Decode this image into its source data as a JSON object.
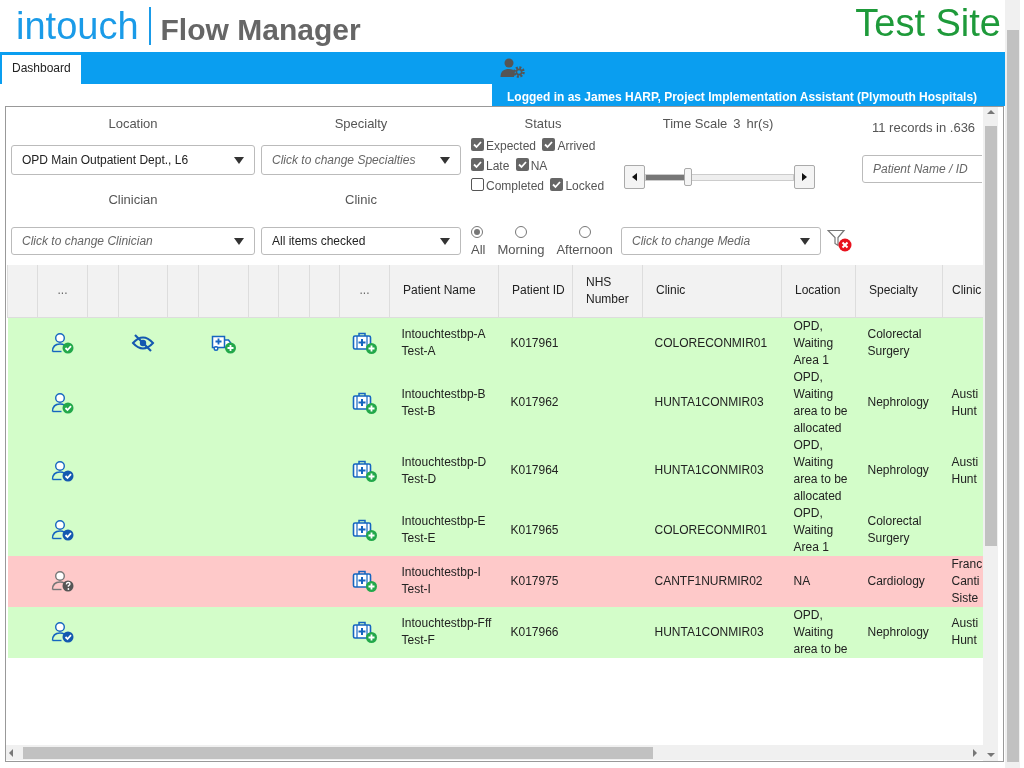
{
  "header": {
    "logo": "intouch",
    "app_name": "Flow Manager",
    "site_label": "Test Site"
  },
  "nav": {
    "tabs": [
      {
        "label": "Dashboard",
        "selected": true
      }
    ],
    "logged_in": "Logged in as James HARP, Project Implementation Assistant (Plymouth Hospitals)"
  },
  "filters": {
    "location": {
      "label": "Location",
      "value": "OPD Main Outpatient Dept., L6"
    },
    "specialty": {
      "label": "Specialty",
      "placeholder": "Click to change Specialties"
    },
    "clinician": {
      "label": "Clinician",
      "placeholder": "Click to change Clinician"
    },
    "clinic": {
      "label": "Clinic",
      "value": "All items checked"
    },
    "status": {
      "label": "Status",
      "options": [
        {
          "label": "Expected",
          "checked": true
        },
        {
          "label": "Arrived",
          "checked": true
        },
        {
          "label": "Late",
          "checked": true
        },
        {
          "label": "NA",
          "checked": true
        },
        {
          "label": "Completed",
          "checked": false
        },
        {
          "label": "Locked",
          "checked": true
        }
      ]
    },
    "session": {
      "options": [
        {
          "label": "All",
          "selected": true
        },
        {
          "label": "Morning",
          "selected": false
        },
        {
          "label": "Afternoon",
          "selected": false
        }
      ]
    },
    "time_scale": {
      "label": "Time Scale",
      "value": "3",
      "unit": "hr(s)",
      "level": 0.29
    },
    "media": {
      "placeholder": "Click to change Media"
    },
    "records": "11 records in .636",
    "search": {
      "placeholder": "Patient Name / ID"
    }
  },
  "table": {
    "columns": [
      {
        "kind": "blank"
      },
      {
        "kind": "text",
        "label": "..."
      },
      {
        "kind": "blank"
      },
      {
        "kind": "blank"
      },
      {
        "kind": "blank"
      },
      {
        "kind": "blank"
      },
      {
        "kind": "blank"
      },
      {
        "kind": "blank"
      },
      {
        "kind": "blank"
      },
      {
        "kind": "text",
        "label": "..."
      },
      {
        "kind": "text",
        "label": "Patient Name"
      },
      {
        "kind": "text",
        "label": "Patient ID"
      },
      {
        "kind": "text",
        "label": "NHS Number"
      },
      {
        "kind": "text",
        "label": "Clinic"
      },
      {
        "kind": "text",
        "label": "Location"
      },
      {
        "kind": "text",
        "label": "Specialty"
      },
      {
        "kind": "text",
        "label": "Clinic"
      }
    ],
    "rows": [
      {
        "color": "#d3fdc9",
        "kind": "green-check",
        "hidden": true,
        "transport": true,
        "name": "Intouchtestbp-A Test-A",
        "patient_id": "K017961",
        "clinic": "COLORECONMIR01",
        "location": "OPD, Waiting Area 1",
        "specialty": "Colorectal Surgery"
      },
      {
        "color": "#d3fdc9",
        "kind": "green-check",
        "hidden": false,
        "transport": false,
        "name": "Intouchtestbp-B Test-B",
        "patient_id": "K017962",
        "clinic": "HUNTA1CONMIR03",
        "location": "OPD, Waiting area to be allocated",
        "specialty": "Nephrology",
        "clinician": "Austi Hunt"
      },
      {
        "color": "#d3fdc9",
        "kind": "blue-check",
        "hidden": false,
        "transport": false,
        "name": "Intouchtestbp-D Test-D",
        "patient_id": "K017964",
        "clinic": "HUNTA1CONMIR03",
        "location": "OPD, Waiting area to be allocated",
        "specialty": "Nephrology",
        "clinician": "Austi Hunt"
      },
      {
        "color": "#d3fdc9",
        "kind": "blue-check",
        "hidden": false,
        "transport": false,
        "name": "Intouchtestbp-E Test-E",
        "patient_id": "K017965",
        "clinic": "COLORECONMIR01",
        "location": "OPD, Waiting Area 1",
        "specialty": "Colorectal Surgery"
      },
      {
        "color": "#fec9c9",
        "kind": "question",
        "hidden": false,
        "transport": false,
        "name": "Intouchtestbp-I Test-I",
        "patient_id": "K017975",
        "clinic": "CANTF1NURMIR02",
        "location": "NA",
        "specialty": "Cardiology",
        "clinician": "Franc Canti Siste"
      },
      {
        "color": "#d3fdc9",
        "kind": "blue-check",
        "hidden": false,
        "transport": false,
        "name": "Intouchtestbp-Fff Test-F",
        "patient_id": "K017966",
        "clinic": "HUNTA1CONMIR03",
        "location": "OPD, Waiting area to be",
        "specialty": "Nephrology",
        "clinician": "Austi Hunt"
      }
    ]
  }
}
